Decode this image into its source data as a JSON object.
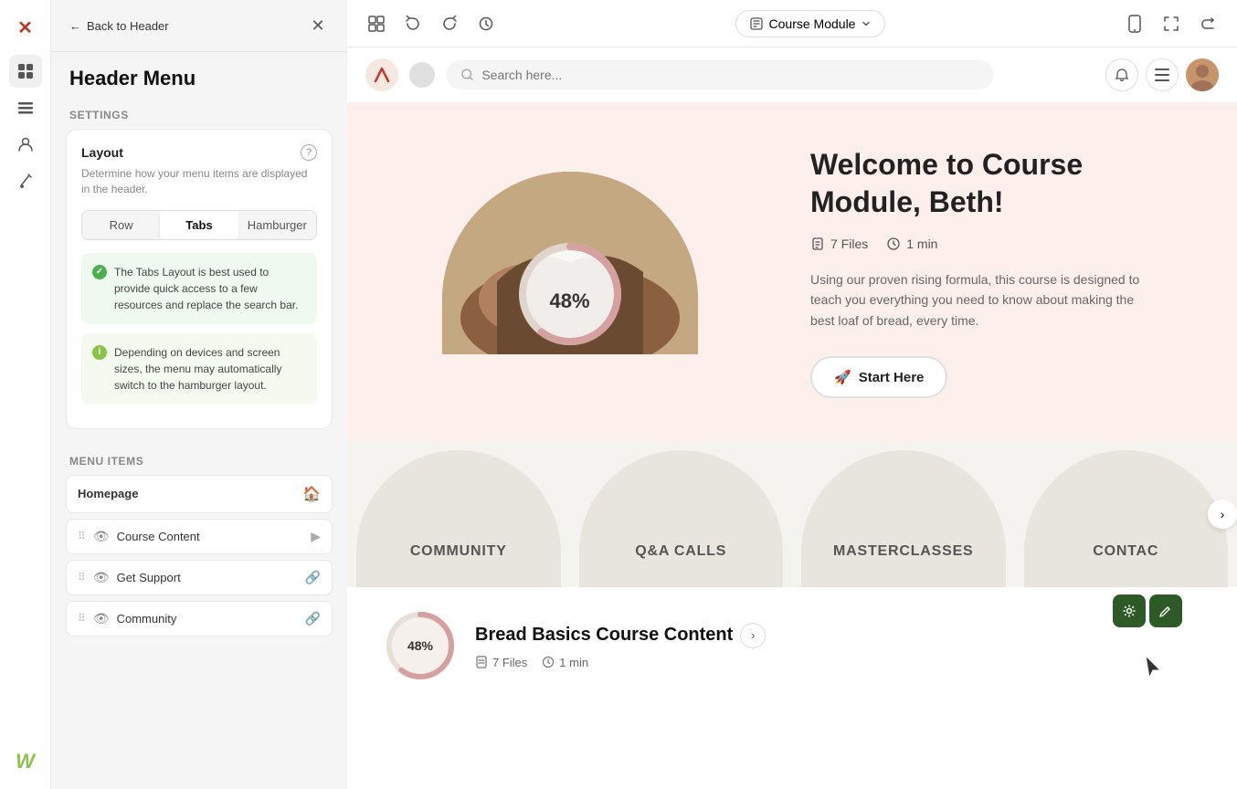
{
  "app": {
    "title": "Header Menu"
  },
  "sidebar": {
    "back_label": "Back to Header",
    "title": "Header Menu",
    "settings_label": "Settings",
    "layout": {
      "title": "Layout",
      "description": "Determine how your menu items are displayed in the header.",
      "options": [
        "Row",
        "Tabs",
        "Hamburger"
      ],
      "active": "Tabs",
      "tip1": "The Tabs Layout is best used to provide quick access to a few resources and replace the search bar.",
      "tip2": "Depending on devices and screen sizes, the menu may automatically switch to the hamburger layout."
    },
    "menu_items_label": "Menu Items",
    "items": [
      {
        "label": "Homepage",
        "type": "home"
      },
      {
        "label": "Course Content",
        "type": "video"
      },
      {
        "label": "Get Support",
        "type": "link"
      },
      {
        "label": "Community",
        "type": "link"
      }
    ]
  },
  "toolbar": {
    "module_label": "Course Module",
    "undo_title": "Undo",
    "redo_title": "Redo",
    "history_title": "History"
  },
  "nav": {
    "search_placeholder": "Search here..."
  },
  "hero": {
    "title": "Welcome to Course Module, Beth!",
    "files_count": "7 Files",
    "duration": "1 min",
    "description": "Using our proven rising formula, this course is designed to teach you everything you need to know about making the best loaf of bread, every time.",
    "start_btn": "Start Here",
    "progress": "48%"
  },
  "menu_tiles": [
    {
      "label": "COMMUNITY"
    },
    {
      "label": "Q&A CALLS"
    },
    {
      "label": "MASTERCLASSES"
    },
    {
      "label": "CONTAC"
    }
  ],
  "course_card": {
    "title": "Bread Basics Course Content",
    "files": "7 Files",
    "duration": "1 min",
    "progress": "48%"
  },
  "icons": {
    "brand": "✕",
    "pages": "⊞",
    "layout": "☰",
    "users": "👤",
    "brush": "✏",
    "w_logo": "W",
    "back_arrow": "←",
    "close": "✕",
    "undo": "↺",
    "redo": "↻",
    "history": "🕐",
    "chevron_down": "⌄",
    "mobile": "📱",
    "expand": "⤢",
    "share": "⎋",
    "search": "🔍",
    "bell": "🔔",
    "menu": "☰",
    "files": "📄",
    "clock": "🕐",
    "rocket": "🚀",
    "gear": "⚙",
    "paint": "🖌",
    "arrow_right": "›",
    "check": "✓",
    "info": "i",
    "home": "🏠",
    "video": "▶",
    "link": "🔗"
  }
}
